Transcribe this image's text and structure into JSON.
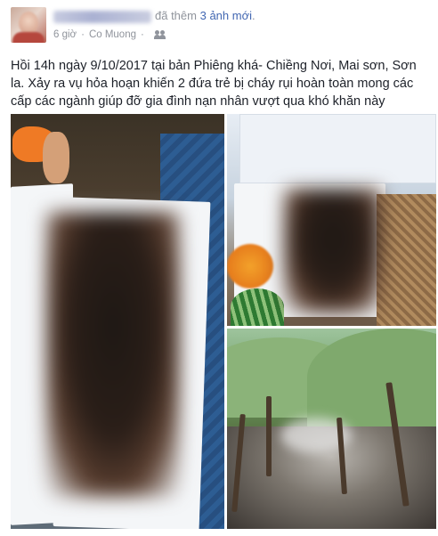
{
  "post": {
    "action_text": "đã thêm",
    "photo_count_link": "3 ảnh mới",
    "period": ".",
    "sub_line": {
      "time": "6 giờ",
      "separator": "·",
      "location": "Co Muong",
      "audience_icon": "friends-icon"
    },
    "caption": "Hồi 14h ngày 9/10/2017 tại bản Phiêng khá- Chiềng Nơi, Mai sơn, Sơn la. Xảy ra vụ hỏa hoạn khiến 2 đứa trẻ bị cháy rụi hoàn toàn mong các cấp các ngành giúp đỡ gia đình nạn nhân vượt qua khó khăn này",
    "photos": [
      {
        "id": "photo-1",
        "description_icon": "image"
      },
      {
        "id": "photo-2",
        "description_icon": "image"
      },
      {
        "id": "photo-3",
        "description_icon": "image"
      }
    ]
  },
  "colors": {
    "link": "#4267b2",
    "meta": "#90949c",
    "text": "#1d2129"
  }
}
